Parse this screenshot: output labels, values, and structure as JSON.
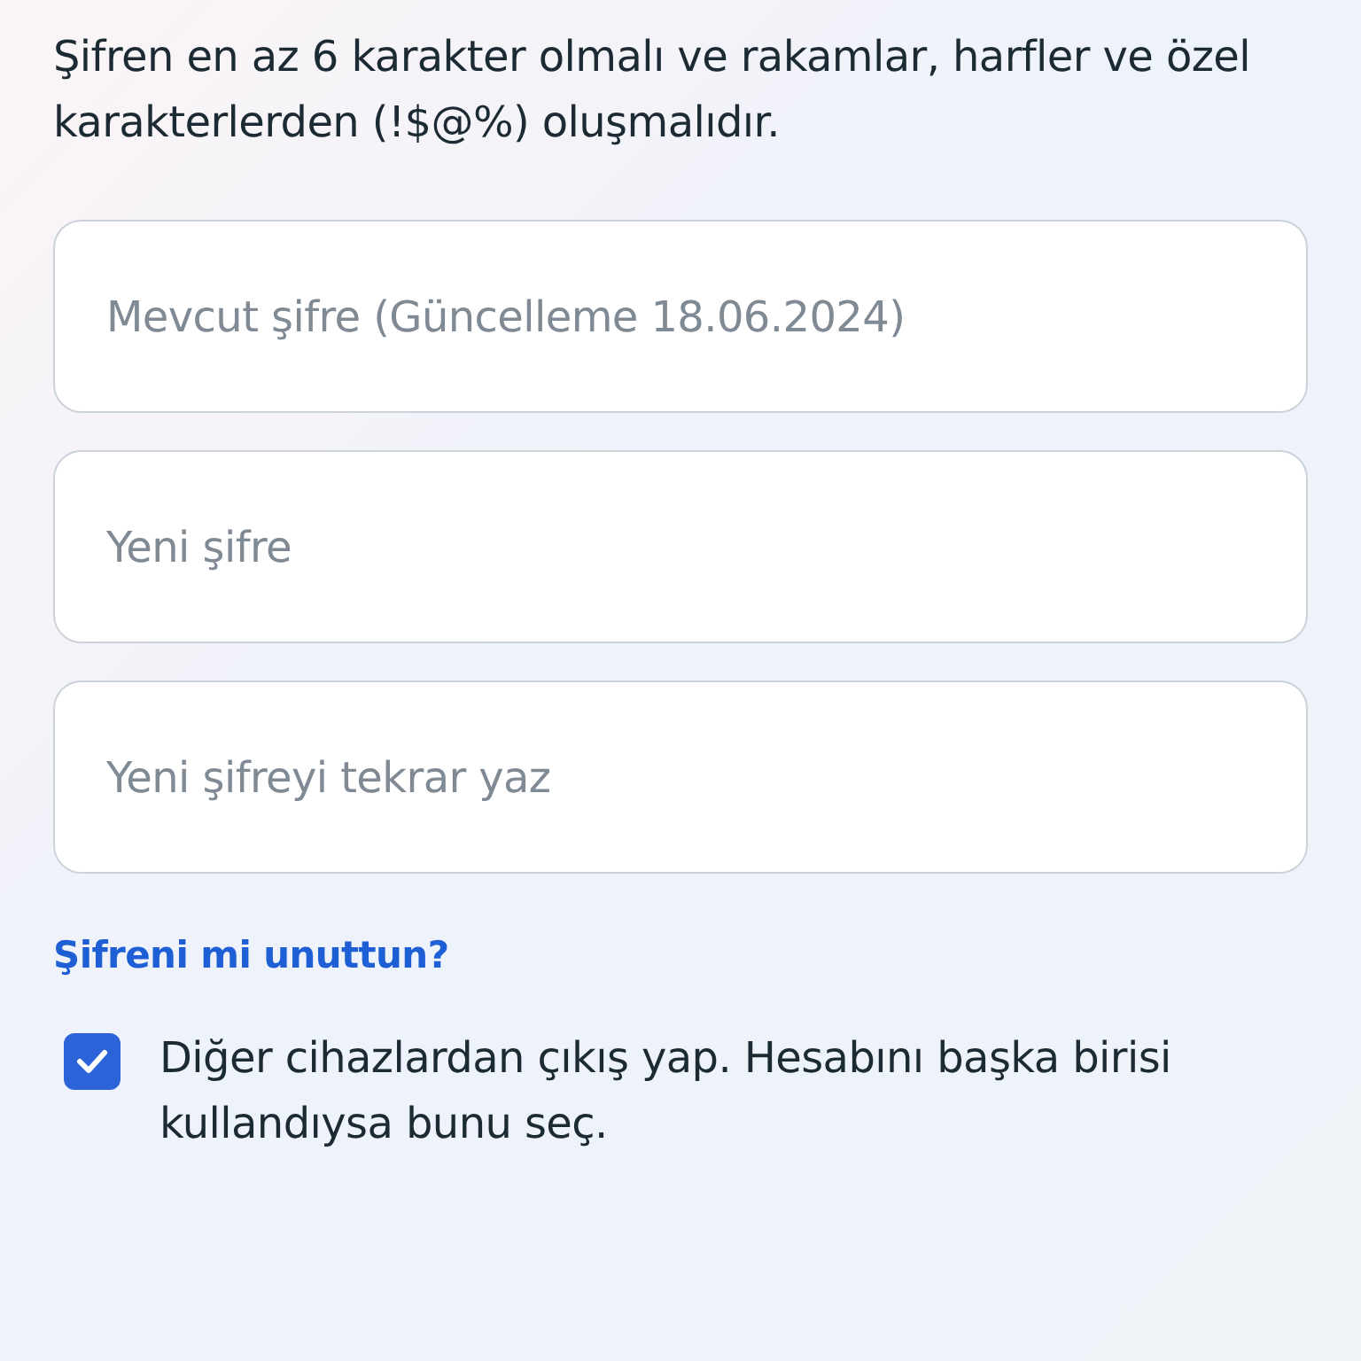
{
  "info_text": "Şifren en az 6 karakter olmalı ve rakamlar, harfler ve özel karakterlerden (!$@%) oluşmalıdır.",
  "fields": [
    {
      "placeholder": "Mevcut şifre (Güncelleme 18.06.2024)"
    },
    {
      "placeholder": "Yeni şifre"
    },
    {
      "placeholder": "Yeni şifreyi tekrar yaz"
    }
  ],
  "forgot_link": "Şifreni mi unuttun?",
  "logout_option": {
    "label": "Diğer cihazlardan çıkış yap. Hesabını başka birisi kullandıysa bunu seç.",
    "checked": true
  }
}
